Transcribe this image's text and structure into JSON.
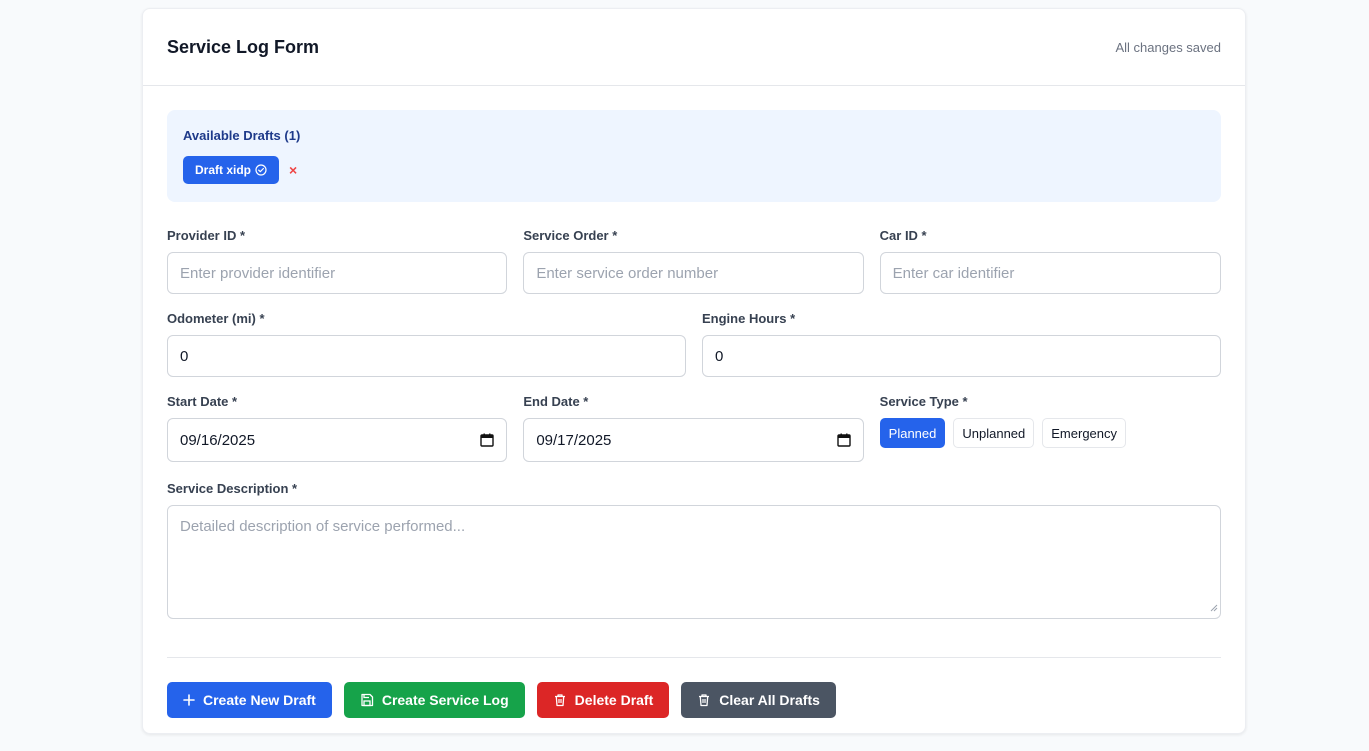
{
  "header": {
    "title": "Service Log Form",
    "save_status": "All changes saved"
  },
  "drafts": {
    "title": "Available Drafts (1)",
    "items": [
      {
        "label": "Draft xidp",
        "status_icon": "check-circle-icon",
        "remove_symbol": "×"
      }
    ]
  },
  "fields": {
    "provider_id": {
      "label": "Provider ID *",
      "placeholder": "Enter provider identifier",
      "value": ""
    },
    "service_order": {
      "label": "Service Order *",
      "placeholder": "Enter service order number",
      "value": ""
    },
    "car_id": {
      "label": "Car ID *",
      "placeholder": "Enter car identifier",
      "value": ""
    },
    "odometer": {
      "label": "Odometer (mi) *",
      "value": "0"
    },
    "engine_hours": {
      "label": "Engine Hours *",
      "value": "0"
    },
    "start_date": {
      "label": "Start Date *",
      "value": "09/16/2025"
    },
    "end_date": {
      "label": "End Date *",
      "value": "09/17/2025"
    },
    "service_type": {
      "label": "Service Type *",
      "options": [
        "Planned",
        "Unplanned",
        "Emergency"
      ],
      "selected": "Planned"
    },
    "description": {
      "label": "Service Description *",
      "placeholder": "Detailed description of service performed..."
    }
  },
  "actions": {
    "create_draft": "Create New Draft",
    "create_log": "Create Service Log",
    "delete_draft": "Delete Draft",
    "clear_drafts": "Clear All Drafts"
  },
  "colors": {
    "primary": "#2563eb",
    "success": "#16a34a",
    "danger": "#dc2626",
    "neutral": "#4b5563",
    "drafts_bg": "#eef5ff"
  }
}
